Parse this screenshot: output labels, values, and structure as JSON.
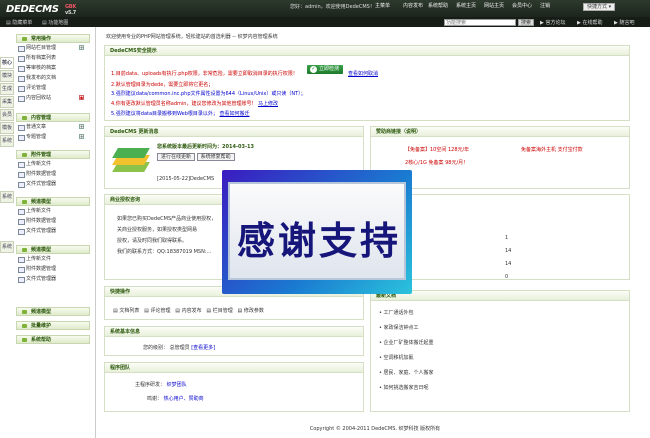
{
  "topbar": {
    "logo": "DEDECMS",
    "version": "v5.7",
    "version_badge": "GBK",
    "welcome": "您好：admin，欢迎使用DedeCMS！",
    "nav": [
      "主菜单",
      "内容发布",
      "系统帮助",
      "系统主页",
      "网站主页",
      "会员中心",
      "注销"
    ],
    "skin_label": "快捷方式",
    "hide_menu": "隐藏菜单",
    "sitemap": "功能地图",
    "search_placeholder": "功能搜索",
    "search_btn": "搜索",
    "official": "官方论坛",
    "online_help": "在线帮助",
    "notes": "随言吧"
  },
  "side_tabs": [
    "核心",
    "模块",
    "生成",
    "采集",
    "会员",
    "模板",
    "系统",
    "系统",
    "系统"
  ],
  "side": {
    "s1": {
      "title": "常用操作",
      "items": [
        "网站栏目管理",
        "所有档案列表",
        "等审核的档案",
        "我发布的文档",
        "评论管理",
        "内容回收站"
      ]
    },
    "s2": {
      "title": "内容管理",
      "items": [
        "普通文章",
        "专题管理"
      ]
    },
    "s3": {
      "title": "附件管理",
      "items": [
        "上传新文件",
        "附件数据管理",
        "文件式管理器"
      ]
    },
    "s4": {
      "title": "频道模型",
      "items": [
        "上传新文件",
        "附件数据管理",
        "文件式管理器"
      ]
    },
    "s5": {
      "title": "频道模型",
      "items": [
        "上传新文件",
        "附件数据管理",
        "文件式管理器"
      ]
    },
    "s6": {
      "title": "频道模型"
    },
    "s7": {
      "title": "批量维护"
    },
    "s8": {
      "title": "系统帮助"
    }
  },
  "main": {
    "crumb": "欢迎使用专业的PHP网站管理系统，轻松建站的首选利器 -- 织梦内容管理系统",
    "security": {
      "title": "DedeCMS安全提示",
      "l1": "1.目前data、uploads有执行.php权限，非常危险，需要立即取消目录的执行权限！",
      "l2": "2.默认管理目录为dede，需要立即将它更名；",
      "l3": "3.强烈建议data/common.inc.php文件属性设置为644（Linux/Unix）或只读（NT）；",
      "l4": "4.你有更改默认管理员名称admin，建议您修改为其他管理账号！",
      "l4link": "马上修改",
      "l5": "5.强烈建议将data目录搬移到Web根目录以外；",
      "l5link": "查看如何搬迁",
      "checkbtn": "立即检测",
      "howlink": "查看如何取消"
    },
    "update": {
      "title": "DedeCMS 更新消息",
      "headline": "您系统版本最后更新时间为：2014-03-13",
      "btn1": "进行在线更新",
      "btn2": "系统修复帮助",
      "date": "[2015-05-22]DedeCMS",
      "date2": "[2014-..."
    },
    "partner": {
      "title": "赞助商链接（说明）",
      "l1": "【免备案】10空间 128元/年",
      "l2": "免备案海外主机 支付宝付款",
      "l3": "2核心/1G 免备案 98元/月！"
    },
    "license": {
      "title": "商业授权咨询",
      "l1": "如果您已购买DedeCMS产品商业使用授权，",
      "l2": "关商业授权服务，如果授权类型网易",
      "l3": "授权，请及时同我们取得联系。",
      "l4": "我们的联系方式：QQ:18387019 MSN:..."
    },
    "stats": {
      "n1": "1",
      "n2": "14",
      "n3": "14",
      "n4": "0"
    },
    "quick": {
      "title": "快捷操作",
      "items": [
        "文档列表",
        "评论管理",
        "内容发布",
        "栏目管理",
        "修改参数"
      ]
    },
    "latest": {
      "title": "最新文档",
      "items": [
        "工厂通话外包",
        "家政保洁钟点工",
        "企业厂矿整体搬迁起重",
        "空调移机加氟",
        "居民、家庭、个人搬家",
        "如何挑选搬家吉日呢"
      ]
    },
    "sysinfo": {
      "title": "系统基本信息",
      "label": "您的级别：",
      "value": "总管理员",
      "more": "[查看更多]"
    },
    "team": {
      "title": "程序团队",
      "l1label": "主程序研发：",
      "l1value": "织梦团队",
      "l2label": "鸣谢：",
      "l2value": "热心用户、赞助商"
    },
    "overlay_text": "感谢支持"
  },
  "footer": "Copyright © 2004-2011 DedeCMS. 织梦科技 版权所有"
}
